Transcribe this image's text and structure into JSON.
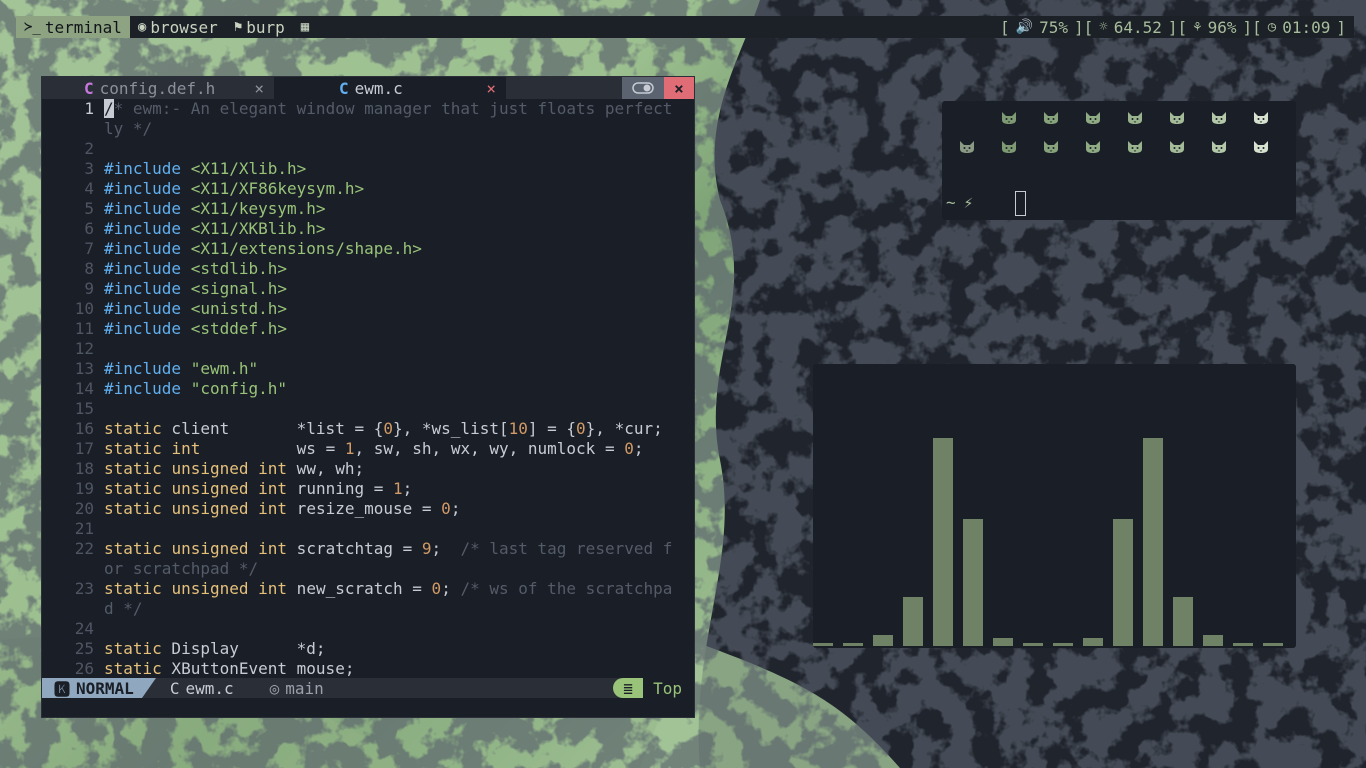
{
  "colors": {
    "wallpaper_light": "#a3c497",
    "wallpaper_dark": "#20242d",
    "bar_bg": "#1c2027",
    "accent": "#8ea381",
    "mode_bg": "#8fa7bf",
    "close_red": "#e06c75",
    "visualizer_bar": "#6f8266"
  },
  "topbar": {
    "workspaces": [
      {
        "icon": "terminal-icon",
        "glyph": "≻_",
        "label": "terminal",
        "active": true
      },
      {
        "icon": "chrome-icon",
        "glyph": "◉",
        "label": "browser",
        "active": false
      },
      {
        "icon": "flag-icon",
        "glyph": "⚑",
        "label": "burp",
        "active": false
      },
      {
        "icon": "grid-icon",
        "glyph": "▦",
        "label": "",
        "active": false
      }
    ],
    "status": {
      "open": "[",
      "sep": "][",
      "close": "]",
      "volume_glyph": "🔊",
      "volume": "75%",
      "brightness_glyph": "☼",
      "brightness": "64.52",
      "battery_glyph": "⚘",
      "battery": "96%",
      "clock_glyph": "◷",
      "time": "01:09"
    }
  },
  "editor": {
    "tabs": [
      {
        "icon_glyph": "C",
        "label": "config.def.h",
        "close": "×",
        "active": false
      },
      {
        "icon_glyph": "C",
        "label": "ewm.c",
        "close": "×",
        "active": true
      }
    ],
    "close_button": "×",
    "lines": [
      {
        "n": "1",
        "html": "<span class=\"cursor\">/</span><span class=\"cm\">* ewm:- An elegant window manager that just floats perfect</span>",
        "cur": true
      },
      {
        "n": "",
        "html": "<span class=\"cm\">ly */</span>"
      },
      {
        "n": "2",
        "html": ""
      },
      {
        "n": "3",
        "html": "<span class=\"pp\">#include</span> <span class=\"str\">&lt;X11/Xlib.h&gt;</span>"
      },
      {
        "n": "4",
        "html": "<span class=\"pp\">#include</span> <span class=\"str\">&lt;X11/XF86keysym.h&gt;</span>"
      },
      {
        "n": "5",
        "html": "<span class=\"pp\">#include</span> <span class=\"str\">&lt;X11/keysym.h&gt;</span>"
      },
      {
        "n": "6",
        "html": "<span class=\"pp\">#include</span> <span class=\"str\">&lt;X11/XKBlib.h&gt;</span>"
      },
      {
        "n": "7",
        "html": "<span class=\"pp\">#include</span> <span class=\"str\">&lt;X11/extensions/shape.h&gt;</span>"
      },
      {
        "n": "8",
        "html": "<span class=\"pp\">#include</span> <span class=\"str\">&lt;stdlib.h&gt;</span>"
      },
      {
        "n": "9",
        "html": "<span class=\"pp\">#include</span> <span class=\"str\">&lt;signal.h&gt;</span>"
      },
      {
        "n": "10",
        "html": "<span class=\"pp\">#include</span> <span class=\"str\">&lt;unistd.h&gt;</span>"
      },
      {
        "n": "11",
        "html": "<span class=\"pp\">#include</span> <span class=\"str\">&lt;stddef.h&gt;</span>"
      },
      {
        "n": "12",
        "html": ""
      },
      {
        "n": "13",
        "html": "<span class=\"pp\">#include</span> <span class=\"str\">\"ewm.h\"</span>"
      },
      {
        "n": "14",
        "html": "<span class=\"pp\">#include</span> <span class=\"str\">\"config.h\"</span>"
      },
      {
        "n": "15",
        "html": ""
      },
      {
        "n": "16",
        "html": "<span class=\"kw\">static</span> client       *list = {<span class=\"num\">0</span>}, *ws_list[<span class=\"num\">10</span>] = {<span class=\"num\">0</span>}, *cur;"
      },
      {
        "n": "17",
        "html": "<span class=\"kw\">static</span> <span class=\"kw\">int</span>          ws = <span class=\"num\">1</span>, sw, sh, wx, wy, numlock = <span class=\"num\">0</span>;"
      },
      {
        "n": "18",
        "html": "<span class=\"kw\">static</span> <span class=\"kw\">unsigned</span> <span class=\"kw\">int</span> ww, wh;"
      },
      {
        "n": "19",
        "html": "<span class=\"kw\">static</span> <span class=\"kw\">unsigned</span> <span class=\"kw\">int</span> running = <span class=\"num\">1</span>;"
      },
      {
        "n": "20",
        "html": "<span class=\"kw\">static</span> <span class=\"kw\">unsigned</span> <span class=\"kw\">int</span> resize_mouse = <span class=\"num\">0</span>;"
      },
      {
        "n": "21",
        "html": ""
      },
      {
        "n": "22",
        "html": "<span class=\"kw\">static</span> <span class=\"kw\">unsigned</span> <span class=\"kw\">int</span> scratchtag = <span class=\"num\">9</span>;  <span class=\"cm\">/* last tag reserved f</span>"
      },
      {
        "n": "",
        "html": "<span class=\"cm\">or scratchpad */</span>"
      },
      {
        "n": "23",
        "html": "<span class=\"kw\">static</span> <span class=\"kw\">unsigned</span> <span class=\"kw\">int</span> new_scratch = <span class=\"num\">0</span>; <span class=\"cm\">/* ws of the scratchpa</span>"
      },
      {
        "n": "",
        "html": "<span class=\"cm\">d */</span>"
      },
      {
        "n": "24",
        "html": ""
      },
      {
        "n": "25",
        "html": "<span class=\"kw\">static</span> Display      *d;"
      },
      {
        "n": "26",
        "html": "<span class=\"kw\">static</span> XButtonEvent mouse;"
      }
    ],
    "statusline": {
      "mode_glyph": "🅺",
      "mode": "NORMAL",
      "file_glyph": "C",
      "file": "ewm.c",
      "branch_glyph": "◎",
      "branch": "main",
      "pos_glyph": "≣",
      "position": "Top"
    }
  },
  "terminal": {
    "cat_rows": [
      {
        "count": 7,
        "colors": [
          "#7d9a72",
          "#86a37b",
          "#8fab84",
          "#98b38d",
          "#a3bb98",
          "#b2c8a8",
          "#d6e2cf"
        ]
      },
      {
        "count": 8,
        "colors": [
          "#8a9a85",
          "#7d9a72",
          "#86a37b",
          "#8fab84",
          "#98b38d",
          "#a3bb98",
          "#b2c8a8",
          "#d6e2cf"
        ]
      }
    ],
    "prompt_tilde": "~",
    "prompt_bolt": "⚡"
  },
  "visualizer": {
    "levels": [
      0.01,
      0.01,
      0.04,
      0.18,
      0.77,
      0.47,
      0.03,
      0.01,
      0.01,
      0.03,
      0.47,
      0.77,
      0.18,
      0.04,
      0.01,
      0.01
    ]
  }
}
